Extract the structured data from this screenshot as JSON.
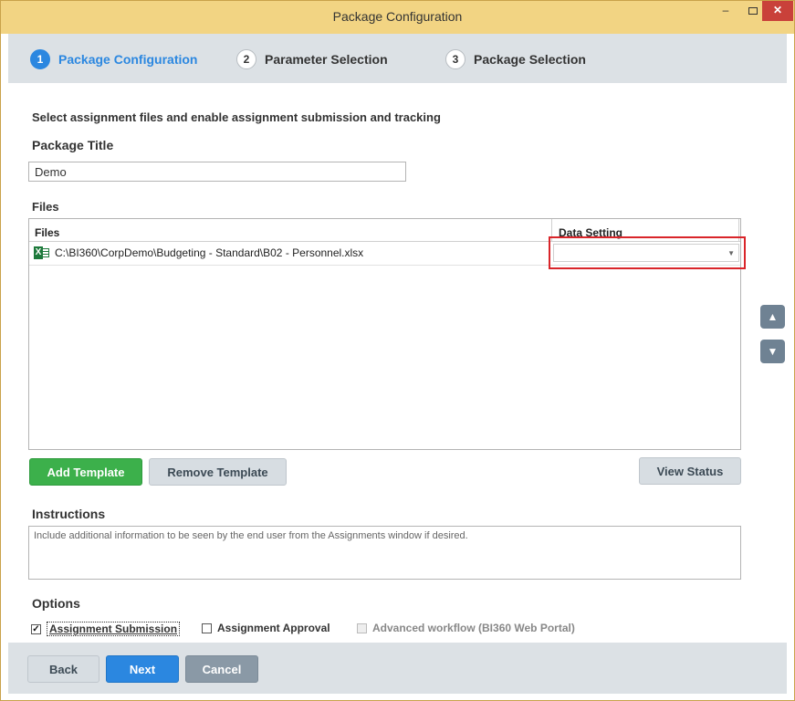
{
  "window": {
    "title": "Package Configuration",
    "minimize_glyph": "–",
    "close_glyph": "✕"
  },
  "steps": [
    {
      "num": "1",
      "label": "Package Configuration",
      "active": true
    },
    {
      "num": "2",
      "label": "Parameter Selection",
      "active": false
    },
    {
      "num": "3",
      "label": "Package Selection",
      "active": false
    }
  ],
  "main": {
    "intro": "Select assignment files and enable assignment submission and tracking",
    "package_title_label": "Package Title",
    "package_title_value": "Demo",
    "files_section_label": "Files",
    "grid": {
      "columns": [
        "Files",
        "Data Setting"
      ],
      "rows": [
        {
          "file_icon": "excel-icon",
          "path": "C:\\BI360\\CorpDemo\\Budgeting - Standard\\B02 - Personnel.xlsx",
          "data_setting": ""
        }
      ]
    },
    "move_up_glyph": "▲",
    "move_down_glyph": "▼",
    "buttons": {
      "add_template": "Add Template",
      "remove_template": "Remove Template",
      "view_status": "View Status"
    },
    "instructions_label": "Instructions",
    "instructions_placeholder": "Include additional information to be seen by the end user from the Assignments window if desired.",
    "options_label": "Options",
    "options": [
      {
        "label": "Assignment Submission",
        "checked": true,
        "enabled": true
      },
      {
        "label": "Assignment Approval",
        "checked": false,
        "enabled": true
      },
      {
        "label": "Advanced workflow (BI360 Web Portal)",
        "checked": false,
        "enabled": false
      }
    ]
  },
  "footer": {
    "back": "Back",
    "next": "Next",
    "cancel": "Cancel"
  },
  "colors": {
    "titlebar": "#f2d483",
    "accent_blue": "#2b87e0",
    "add_green": "#3cb04b",
    "highlight_red": "#d9252a",
    "close_red": "#c9413a"
  }
}
